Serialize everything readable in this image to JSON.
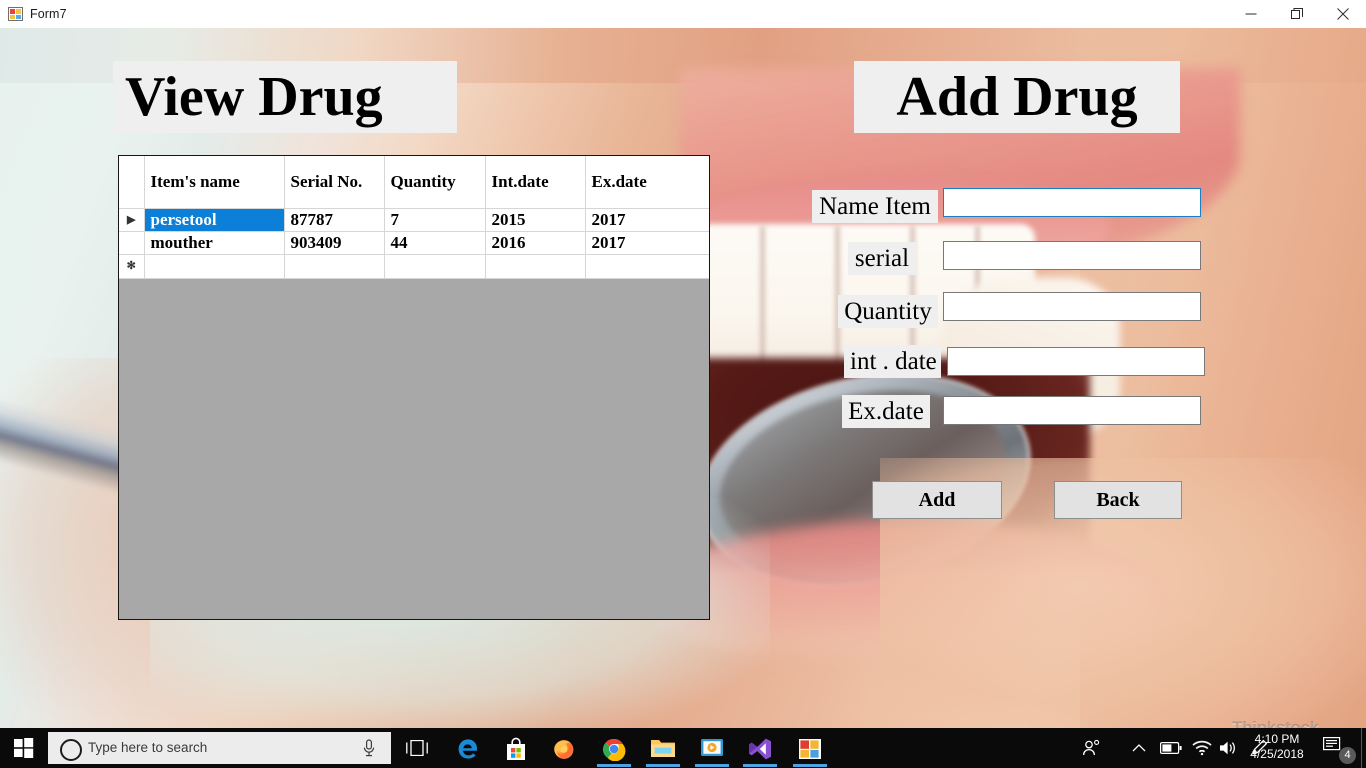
{
  "window": {
    "title": "Form7",
    "icon": "vb-form-icon",
    "controls": {
      "minimize": "minimize-icon",
      "maximize": "restore-icon",
      "close": "close-icon"
    }
  },
  "panels": {
    "view_title": "View Drug",
    "add_title": "Add Drug"
  },
  "grid": {
    "columns": [
      "Item's name",
      "Serial No.",
      "Quantity",
      "Int.date",
      "Ex.date"
    ],
    "row_marker_current": "▶",
    "row_marker_new": "✻",
    "selection_color": "#0c7fd8",
    "rows": [
      {
        "marker": "▶",
        "selected": true,
        "cells": [
          "persetool",
          "87787",
          "7",
          "2015",
          "2017"
        ]
      },
      {
        "marker": "",
        "selected": false,
        "cells": [
          "mouther",
          "903409",
          "44",
          "2016",
          "2017"
        ]
      },
      {
        "marker": "✻",
        "selected": false,
        "cells": [
          "",
          "",
          "",
          "",
          ""
        ]
      }
    ]
  },
  "form": {
    "fields": [
      {
        "label": "Name Item",
        "value": "",
        "focused": true
      },
      {
        "label": "serial",
        "value": "",
        "focused": false
      },
      {
        "label": "Quantity",
        "value": "",
        "focused": false
      },
      {
        "label": "int . date",
        "value": "",
        "focused": false
      },
      {
        "label": "Ex.date",
        "value": "",
        "focused": false
      }
    ],
    "buttons": {
      "add": "Add",
      "back": "Back"
    }
  },
  "watermark": "Thinkstock",
  "taskbar": {
    "start": "windows-start-icon",
    "search_placeholder": "Type here to search",
    "search_value": "",
    "mic": "microphone-icon",
    "task_view": "task-view-icon",
    "apps": [
      {
        "name": "microsoft-edge",
        "running": false
      },
      {
        "name": "microsoft-store",
        "running": false
      },
      {
        "name": "mozilla-firefox",
        "running": false
      },
      {
        "name": "google-chrome",
        "running": true
      },
      {
        "name": "file-explorer",
        "running": true
      },
      {
        "name": "movies-and-tv",
        "running": true
      },
      {
        "name": "visual-studio",
        "running": true
      },
      {
        "name": "visual-basic-app",
        "running": true
      }
    ],
    "tray": {
      "people": "people-icon",
      "show_hidden": "chevron-up-icon",
      "battery": "battery-icon",
      "network": "wifi-icon",
      "volume": "speaker-icon",
      "pen": "pen-workspace-icon"
    },
    "clock": {
      "time": "4:10 PM",
      "date": "4/25/2018"
    },
    "action_center": {
      "icon": "notification-icon",
      "badge": "4"
    }
  }
}
